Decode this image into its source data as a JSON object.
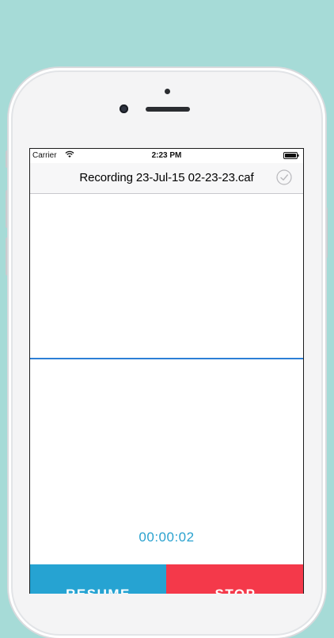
{
  "status_bar": {
    "carrier": "Carrier",
    "time": "2:23 PM",
    "wifi_icon": "wifi-icon",
    "battery_icon": "battery-icon"
  },
  "nav": {
    "title": "Recording 23-Jul-15 02-23-23.caf",
    "done_icon": "checkmark-circle-icon"
  },
  "recorder": {
    "elapsed": "00:00:02"
  },
  "controls": {
    "resume_label": "RESUME",
    "stop_label": "STOP"
  },
  "colors": {
    "background": "#a6dbd7",
    "waveform": "#2d7fd6",
    "timer": "#2aa2cf",
    "resume": "#26a3d2",
    "stop": "#f4394a"
  }
}
